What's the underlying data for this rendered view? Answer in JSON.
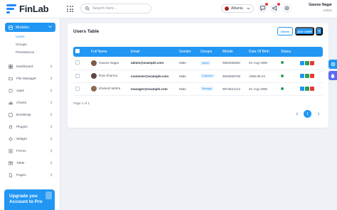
{
  "app": {
    "name": "FinLab"
  },
  "header": {
    "search_placeholder": "Search here...",
    "language": "Albania",
    "user_name": "Gaurav Nagar",
    "user_role": "Admin"
  },
  "sidebar": {
    "active_section": "Modules",
    "sub_items": [
      "Users",
      "Groups",
      "Permissions"
    ],
    "items": [
      {
        "label": "Dashboard",
        "icon": "dashboard-icon"
      },
      {
        "label": "File Manager",
        "icon": "folder-icon"
      },
      {
        "label": "Apps",
        "icon": "apps-icon"
      },
      {
        "label": "Charts",
        "icon": "chart-icon"
      },
      {
        "label": "Bootstrap",
        "icon": "bootstrap-icon"
      },
      {
        "label": "Plugins",
        "icon": "plugin-icon"
      },
      {
        "label": "Widget",
        "icon": "widget-icon"
      },
      {
        "label": "Forms",
        "icon": "form-icon"
      },
      {
        "label": "Table",
        "icon": "table-icon"
      },
      {
        "label": "Pages",
        "icon": "pages-icon"
      }
    ],
    "upgrade_text": "Upgrade you Account to Pro"
  },
  "card": {
    "title": "Users Table",
    "delete_label": "Delete",
    "add_label": "ADD USER",
    "add_more_label": "+"
  },
  "table": {
    "columns": [
      "Full Name",
      "Email",
      "Gender",
      "Groups",
      "Mobile",
      "Date Of Birth",
      "Status"
    ],
    "rows": [
      {
        "name": "Gaurav Nagar",
        "email": "admin@example.com",
        "gender": "Male",
        "group": "Admin",
        "mobile": "9852596692",
        "dob": "01-Aug-1995",
        "avatar_color": "#7a5a48"
      },
      {
        "name": "Ravi Sharma",
        "email": "customer@example.com",
        "gender": "Male",
        "group": "Customer",
        "mobile": "9845865799",
        "dob": "1995-06-24",
        "avatar_color": "#5b4a43"
      },
      {
        "name": "Khelesh Mehra",
        "email": "manager@example.com",
        "gender": "Male",
        "group": "Manager",
        "mobile": "9874521212",
        "dob": "01-Aug-1996",
        "avatar_color": "#8c6a55"
      }
    ],
    "page_info": "Page 1 of 1",
    "current_page": "1"
  },
  "colors": {
    "accent": "#2196f3",
    "status_active": "#2e9e4f"
  }
}
